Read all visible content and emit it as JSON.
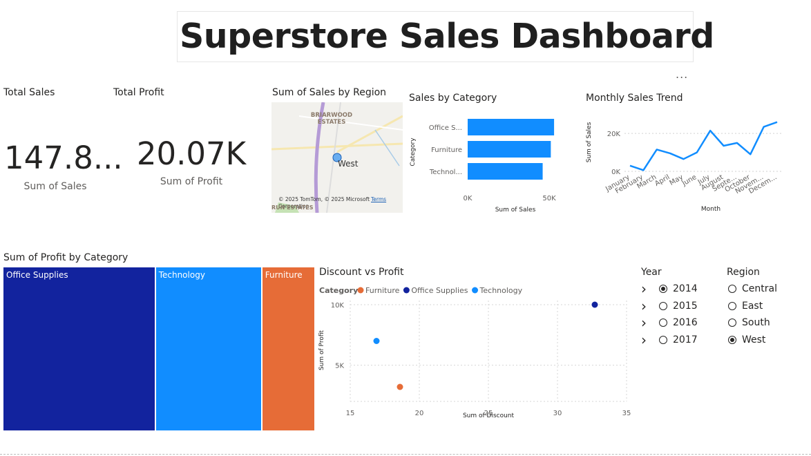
{
  "title": "Superstore Sales Dashboard",
  "more_options": "...",
  "cards": {
    "total_sales": {
      "title": "Total Sales",
      "value": "147.8...",
      "label": "Sum of Sales"
    },
    "total_profit": {
      "title": "Total Profit",
      "value": "20.07K",
      "label": "Sum of Profit"
    }
  },
  "map": {
    "title": "Sum of Sales by Region",
    "place_label": "BRIARWOOD ESTATES",
    "point_label": "West",
    "attribution": "© 2025 TomTom, © 2025 Microsoft Corporation",
    "terms": "Terms",
    "corner_label": "RUN ESTATES",
    "colors": {
      "point": "#6aaef0",
      "road": "#b59bd6"
    }
  },
  "sales_by_category": {
    "title": "Sales by Category",
    "chart_data": {
      "type": "bar",
      "orientation": "horizontal",
      "categories": [
        "Office S...",
        "Furniture",
        "Technol..."
      ],
      "values": [
        53000,
        51000,
        46000
      ],
      "xlabel": "Sum of Sales",
      "ylabel": "Category",
      "xlim": [
        0,
        50000
      ],
      "xticks": [
        "0K",
        "50K"
      ],
      "color": "#118dff"
    }
  },
  "monthly_trend": {
    "title": "Monthly Sales Trend",
    "chart_data": {
      "type": "line",
      "x": [
        "January",
        "February",
        "March",
        "April",
        "May",
        "June",
        "July",
        "August",
        "Septe...",
        "October",
        "Novem...",
        "Decem..."
      ],
      "values": [
        3000,
        600,
        11500,
        9500,
        6500,
        10000,
        21500,
        13500,
        15000,
        9000,
        23500,
        26000
      ],
      "xlabel": "Month",
      "ylabel": "Sum of Sales",
      "ylim": [
        0,
        27000
      ],
      "yticks": [
        "0K",
        "20K"
      ],
      "grid": true,
      "color": "#118dff"
    }
  },
  "profit_treemap": {
    "title": "Sum of Profit by Category",
    "chart_data": {
      "type": "treemap",
      "categories": [
        "Office Supplies",
        "Technology",
        "Furniture"
      ],
      "values": [
        9800,
        6840,
        3430
      ],
      "colors": [
        "#12239e",
        "#118dff",
        "#e66c37"
      ]
    }
  },
  "discount_vs_profit": {
    "title": "Discount vs Profit",
    "legend_title": "Category",
    "chart_data": {
      "type": "scatter",
      "series": [
        {
          "name": "Furniture",
          "color": "#e66c37",
          "points": [
            [
              18.6,
              3200
            ]
          ]
        },
        {
          "name": "Office Supplies",
          "color": "#12239e",
          "points": [
            [
              32.7,
              10000
            ]
          ]
        },
        {
          "name": "Technology",
          "color": "#118dff",
          "points": [
            [
              16.9,
              7000
            ]
          ]
        }
      ],
      "xlabel": "Sum of Discount",
      "ylabel": "Sum of Profit",
      "xlim": [
        15,
        35
      ],
      "ylim": [
        2000,
        10000
      ],
      "xticks": [
        "15",
        "20",
        "25",
        "30",
        "35"
      ],
      "yticks": [
        "5K",
        "10K"
      ],
      "grid": true,
      "legend": "top-left"
    }
  },
  "year_slicer": {
    "title": "Year",
    "items": [
      {
        "label": "2014",
        "selected": true
      },
      {
        "label": "2015",
        "selected": false
      },
      {
        "label": "2016",
        "selected": false
      },
      {
        "label": "2017",
        "selected": false
      }
    ]
  },
  "region_slicer": {
    "title": "Region",
    "items": [
      {
        "label": "Central",
        "selected": false
      },
      {
        "label": "East",
        "selected": false
      },
      {
        "label": "South",
        "selected": false
      },
      {
        "label": "West",
        "selected": true
      }
    ]
  }
}
